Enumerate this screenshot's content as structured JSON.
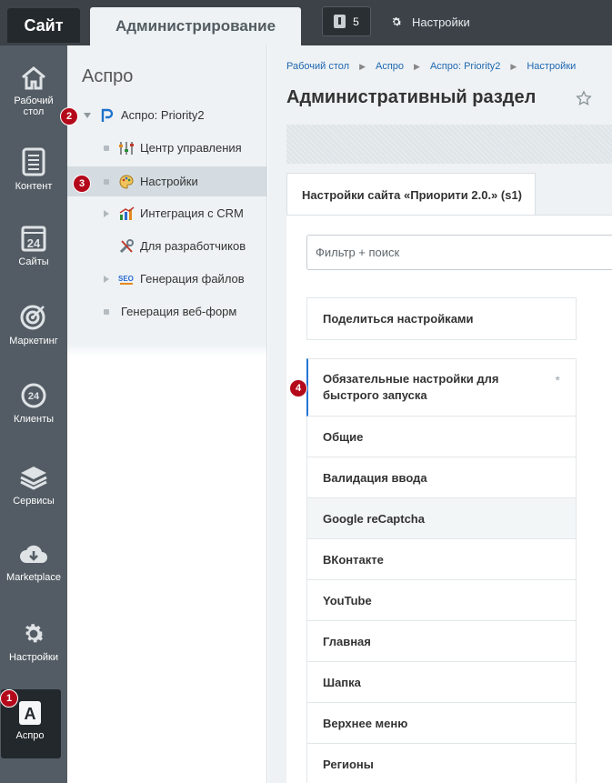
{
  "topbar": {
    "site_tab": "Сайт",
    "admin_tab": "Администрирование",
    "notifications_count": "5",
    "settings_label": "Настройки"
  },
  "leftbar": {
    "items": [
      {
        "label": "Рабочий стол",
        "icon": "home-icon"
      },
      {
        "label": "Контент",
        "icon": "document-icon"
      },
      {
        "label": "Сайты",
        "icon": "calendar-24-icon"
      },
      {
        "label": "Маркетинг",
        "icon": "target-icon"
      },
      {
        "label": "Клиенты",
        "icon": "chat-24-icon"
      },
      {
        "label": "Сервисы",
        "icon": "layers-icon"
      },
      {
        "label": "Marketplace",
        "icon": "cloud-download-icon"
      },
      {
        "label": "Настройки",
        "icon": "gear-icon"
      },
      {
        "label": "Аспро",
        "icon": "aspro-a-icon"
      }
    ],
    "aspro_letter": "A"
  },
  "badges": [
    "1",
    "2",
    "3",
    "4"
  ],
  "tree": {
    "title": "Аспро",
    "root": "Аспро: Priority2",
    "items": [
      {
        "label": "Центр управления"
      },
      {
        "label": "Настройки"
      },
      {
        "label": "Интеграция с CRM"
      },
      {
        "label": "Для разработчиков"
      },
      {
        "label": "Генерация файлов"
      },
      {
        "label": "Генерация веб-форм"
      }
    ]
  },
  "breadcrumb": [
    "Рабочий стол",
    "Аспро",
    "Аспро: Priority2",
    "Настройки"
  ],
  "main": {
    "title": "Административный раздел",
    "tab_label": "Настройки сайта «Приорити 2.0.» (s1)",
    "filter_placeholder": "Фильтр + поиск",
    "share_label": "Поделиться настройками",
    "first_item_line1": "Обязательные настройки для",
    "first_item_line2": "быстрого запуска",
    "first_item_mark": "*",
    "items": [
      "Общие",
      "Валидация ввода",
      "Google reCaptcha",
      "ВКонтакте",
      "YouTube",
      "Главная",
      "Шапка",
      "Верхнее меню",
      "Регионы"
    ]
  },
  "colors": {
    "accent": "#2675d7",
    "badge": "#b4091a",
    "link": "#2067b0"
  }
}
